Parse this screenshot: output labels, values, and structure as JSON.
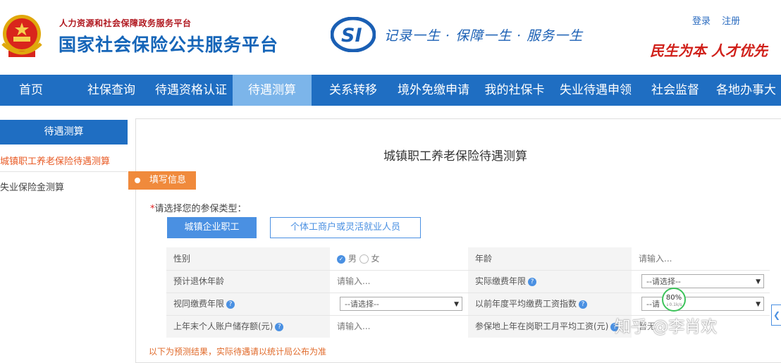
{
  "header": {
    "subtitle": "人力资源和社会保障政务服务平台",
    "title": "国家社会保险公共服务平台",
    "logo_text": "SI",
    "slogan": "记录一生 · 保障一生 · 服务一生",
    "slogan2": "民生为本 人才优先",
    "login": "登录",
    "register": "注册"
  },
  "nav": {
    "items": [
      "首页",
      "社保查询",
      "待遇资格认证",
      "待遇测算",
      "关系转移",
      "境外免缴申请",
      "我的社保卡",
      "失业待遇申领",
      "社会监督",
      "各地办事大"
    ],
    "active_index": 3
  },
  "sidebar": {
    "title": "待遇测算",
    "items": [
      "城镇职工养老保险待遇测算",
      "失业保险金测算"
    ],
    "active_index": 0
  },
  "main": {
    "title": "城镇职工养老保险待遇测算",
    "section_tag": "填写信息",
    "prompt_required_mark": "*",
    "prompt": "请选择您的参保类型：",
    "type_buttons": [
      "城镇企业职工",
      "个体工商户或灵活就业人员"
    ],
    "type_selected_index": 0
  },
  "form": {
    "gender_label": "性别",
    "gender_male": "男",
    "gender_female": "女",
    "age_label": "年龄",
    "age_placeholder": "请输入...",
    "retire_age_label": "预计退休年龄",
    "retire_age_placeholder": "请输入...",
    "actual_years_label": "实际缴费年限",
    "actual_years_select": "--请选择--",
    "deemed_years_label": "视同缴费年限",
    "deemed_years_select": "--请选择--",
    "wage_index_label": "以前年度平均缴费工资指数",
    "wage_index_select": "--请",
    "account_balance_label": "上年末个人账户储存额(元)",
    "account_balance_placeholder": "请输入...",
    "avg_wage_label": "参保地上年在岗职工月平均工资(元)",
    "avg_wage_placeholder": "暂无"
  },
  "progress": {
    "value": "80%",
    "sub": "↓0.1k/s"
  },
  "watermark": "知乎 @李肖欢",
  "side_tab": "❮",
  "bottom_note": "以下为预测结果，实际待遇请以统计局公布为准",
  "colors": {
    "nav": "#1f6ec2",
    "nav_active": "#7cb5ea",
    "tag": "#f08a3c",
    "primary": "#4a90e2"
  }
}
